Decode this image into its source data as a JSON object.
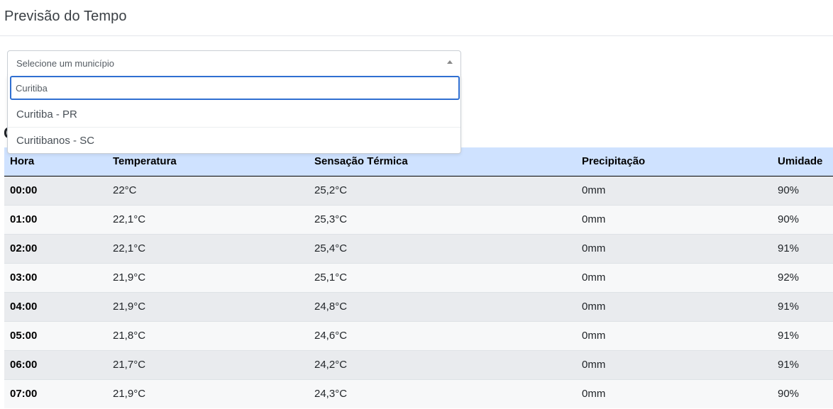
{
  "app": {
    "title": "Previsão do Tempo"
  },
  "section": {
    "title": "C"
  },
  "select": {
    "placeholder": "Selecione um município",
    "search_value": "Curitiba",
    "options": [
      "Curitiba - PR",
      "Curitibanos - SC"
    ]
  },
  "table": {
    "headers": [
      "Hora",
      "Temperatura",
      "Sensação Térmica",
      "Precipitação",
      "Umidade"
    ],
    "rows": [
      [
        "00:00",
        "22°C",
        "25,2°C",
        "0mm",
        "90%"
      ],
      [
        "01:00",
        "22,1°C",
        "25,3°C",
        "0mm",
        "90%"
      ],
      [
        "02:00",
        "22,1°C",
        "25,4°C",
        "0mm",
        "91%"
      ],
      [
        "03:00",
        "21,9°C",
        "25,1°C",
        "0mm",
        "92%"
      ],
      [
        "04:00",
        "21,9°C",
        "24,8°C",
        "0mm",
        "91%"
      ],
      [
        "05:00",
        "21,8°C",
        "24,6°C",
        "0mm",
        "91%"
      ],
      [
        "06:00",
        "21,7°C",
        "24,2°C",
        "0mm",
        "91%"
      ],
      [
        "07:00",
        "21,9°C",
        "24,3°C",
        "0mm",
        "90%"
      ]
    ]
  },
  "colors": {
    "header_bg": "#cfe2ff",
    "focus_border": "#2f6fd1"
  }
}
